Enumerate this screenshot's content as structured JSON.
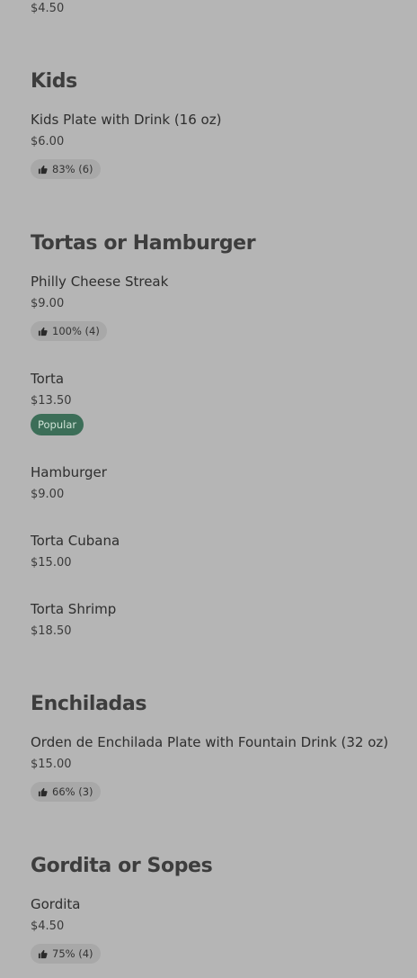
{
  "top": {
    "price": "$4.50"
  },
  "sections": [
    {
      "title": "Kids",
      "items": [
        {
          "name": "Kids Plate with Drink (16 oz)",
          "price": "$6.00",
          "rating": "83% (6)"
        }
      ]
    },
    {
      "title": "Tortas or Hamburger",
      "items": [
        {
          "name": "Philly Cheese Streak",
          "price": "$9.00",
          "rating": "100% (4)"
        },
        {
          "name": "Torta",
          "price": "$13.50",
          "badge": "Popular"
        },
        {
          "name": "Hamburger",
          "price": "$9.00"
        },
        {
          "name": "Torta Cubana",
          "price": "$15.00"
        },
        {
          "name": "Torta Shrimp",
          "price": "$18.50"
        }
      ]
    },
    {
      "title": "Enchiladas",
      "items": [
        {
          "name": "Orden de Enchilada Plate with Fountain Drink (32 oz)",
          "price": "$15.00",
          "rating": "66% (3)"
        }
      ]
    },
    {
      "title": "Gordita or Sopes",
      "items": [
        {
          "name": "Gordita",
          "price": "$4.50",
          "rating": "75% (4)"
        }
      ]
    }
  ],
  "icons": {
    "rating": "thumbs-up-icon"
  },
  "colors": {
    "background": "#b5b5b5",
    "popular_badge": "#3c6e58"
  }
}
